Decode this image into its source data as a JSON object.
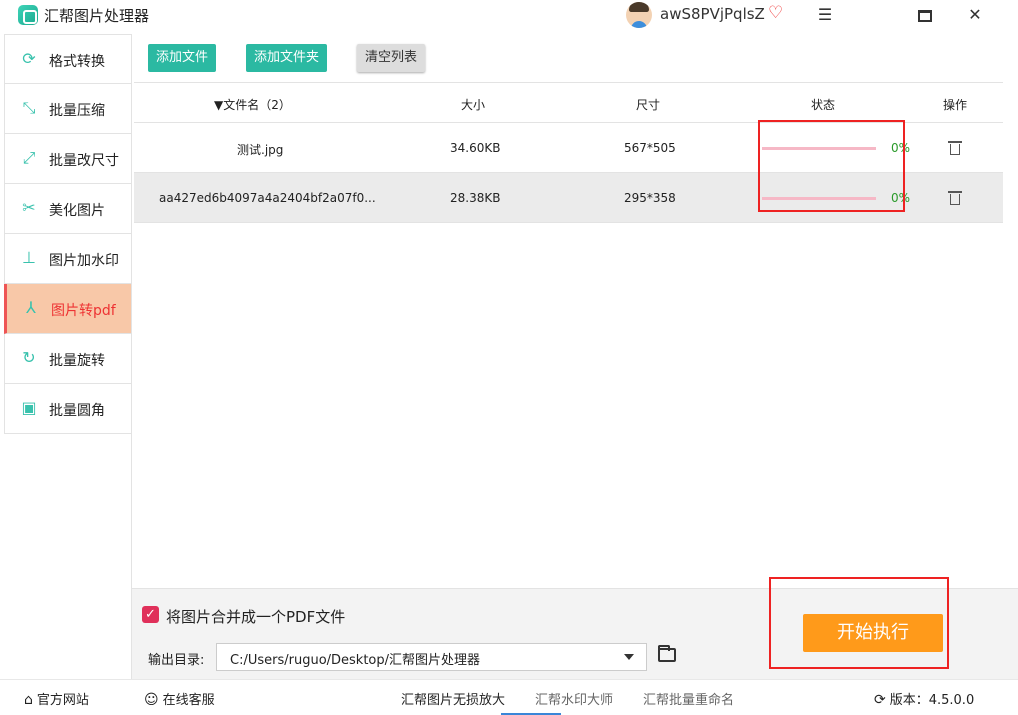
{
  "app": {
    "title": "汇帮图片处理器",
    "username": "awS8PVjPqlsZ"
  },
  "window": {
    "menu_glyph": "☰",
    "minimize_glyph": "▭",
    "close_glyph": "✕"
  },
  "sidebar": {
    "items": [
      {
        "label": "格式转换",
        "icon": "format-icon",
        "glyph": "⟳"
      },
      {
        "label": "批量压缩",
        "icon": "compress-icon",
        "glyph": "⤡"
      },
      {
        "label": "批量改尺寸",
        "icon": "resize-icon",
        "glyph": "⤢"
      },
      {
        "label": "美化图片",
        "icon": "beautify-icon",
        "glyph": "✂"
      },
      {
        "label": "图片加水印",
        "icon": "watermark-icon",
        "glyph": "⊥"
      },
      {
        "label": "图片转pdf",
        "icon": "pdf-icon",
        "glyph": "⅄"
      },
      {
        "label": "批量旋转",
        "icon": "rotate-icon",
        "glyph": "↻"
      },
      {
        "label": "批量圆角",
        "icon": "rounded-corner-icon",
        "glyph": "▣"
      }
    ],
    "active_index": 5
  },
  "toolbar": {
    "add_file": "添加文件",
    "add_folder": "添加文件夹",
    "clear_list": "清空列表"
  },
  "table": {
    "headers": {
      "name": "▼文件名（2）",
      "size": "大小",
      "dimensions": "尺寸",
      "status": "状态",
      "actions": "操作"
    },
    "rows": [
      {
        "name": "测试.jpg",
        "size": "34.60KB",
        "dimensions": "567*505",
        "progress": "0%"
      },
      {
        "name": "aa427ed6b4097a4a2404bf2a07f0...",
        "size": "28.38KB",
        "dimensions": "295*358",
        "progress": "0%"
      }
    ]
  },
  "options": {
    "merge_checked": true,
    "merge_label": "将图片合并成一个PDF文件",
    "output_label": "输出目录:",
    "output_path": "C:/Users/ruguo/Desktop/汇帮图片处理器",
    "run_label": "开始执行"
  },
  "footer": {
    "website": "官方网站",
    "service": "在线客服",
    "upscale": "汇帮图片无损放大",
    "watermark": "汇帮水印大师",
    "rename": "汇帮批量重命名",
    "version": "版本：4.5.0.0"
  },
  "colors": {
    "accent": "#2bb9a2",
    "run": "#ff9a1a",
    "active_bg": "#f8c8a8",
    "highlight": "#e22222"
  }
}
